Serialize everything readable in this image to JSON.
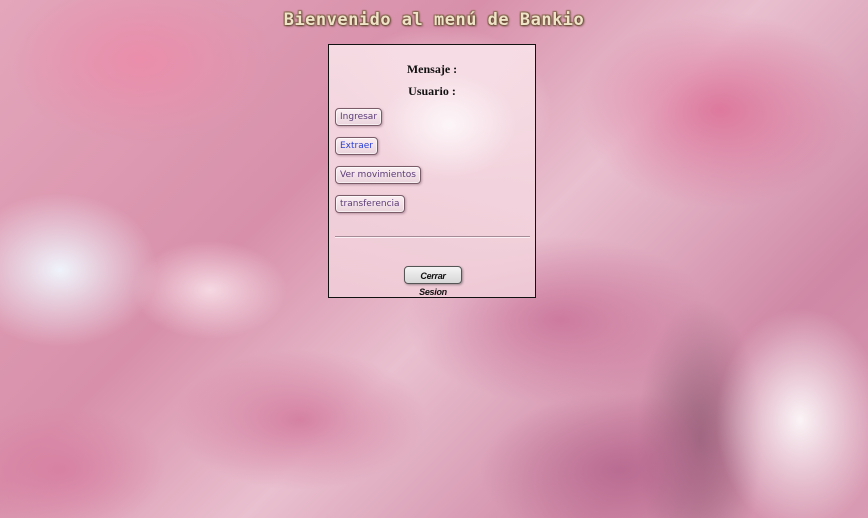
{
  "header": {
    "title": "Bienvenido al menú de Bankio"
  },
  "panel": {
    "message_label": "Mensaje :",
    "user_label": "Usuario :",
    "buttons": {
      "deposit": "Ingresar",
      "withdraw": "Extraer",
      "movements": "Ver movimientos",
      "transfer": "transferencia"
    },
    "logout": "Cerrar Sesion"
  },
  "colors": {
    "link_purple": "#5b3d78",
    "link_blue": "#2a3fd6",
    "title_color": "#efe3c8"
  }
}
